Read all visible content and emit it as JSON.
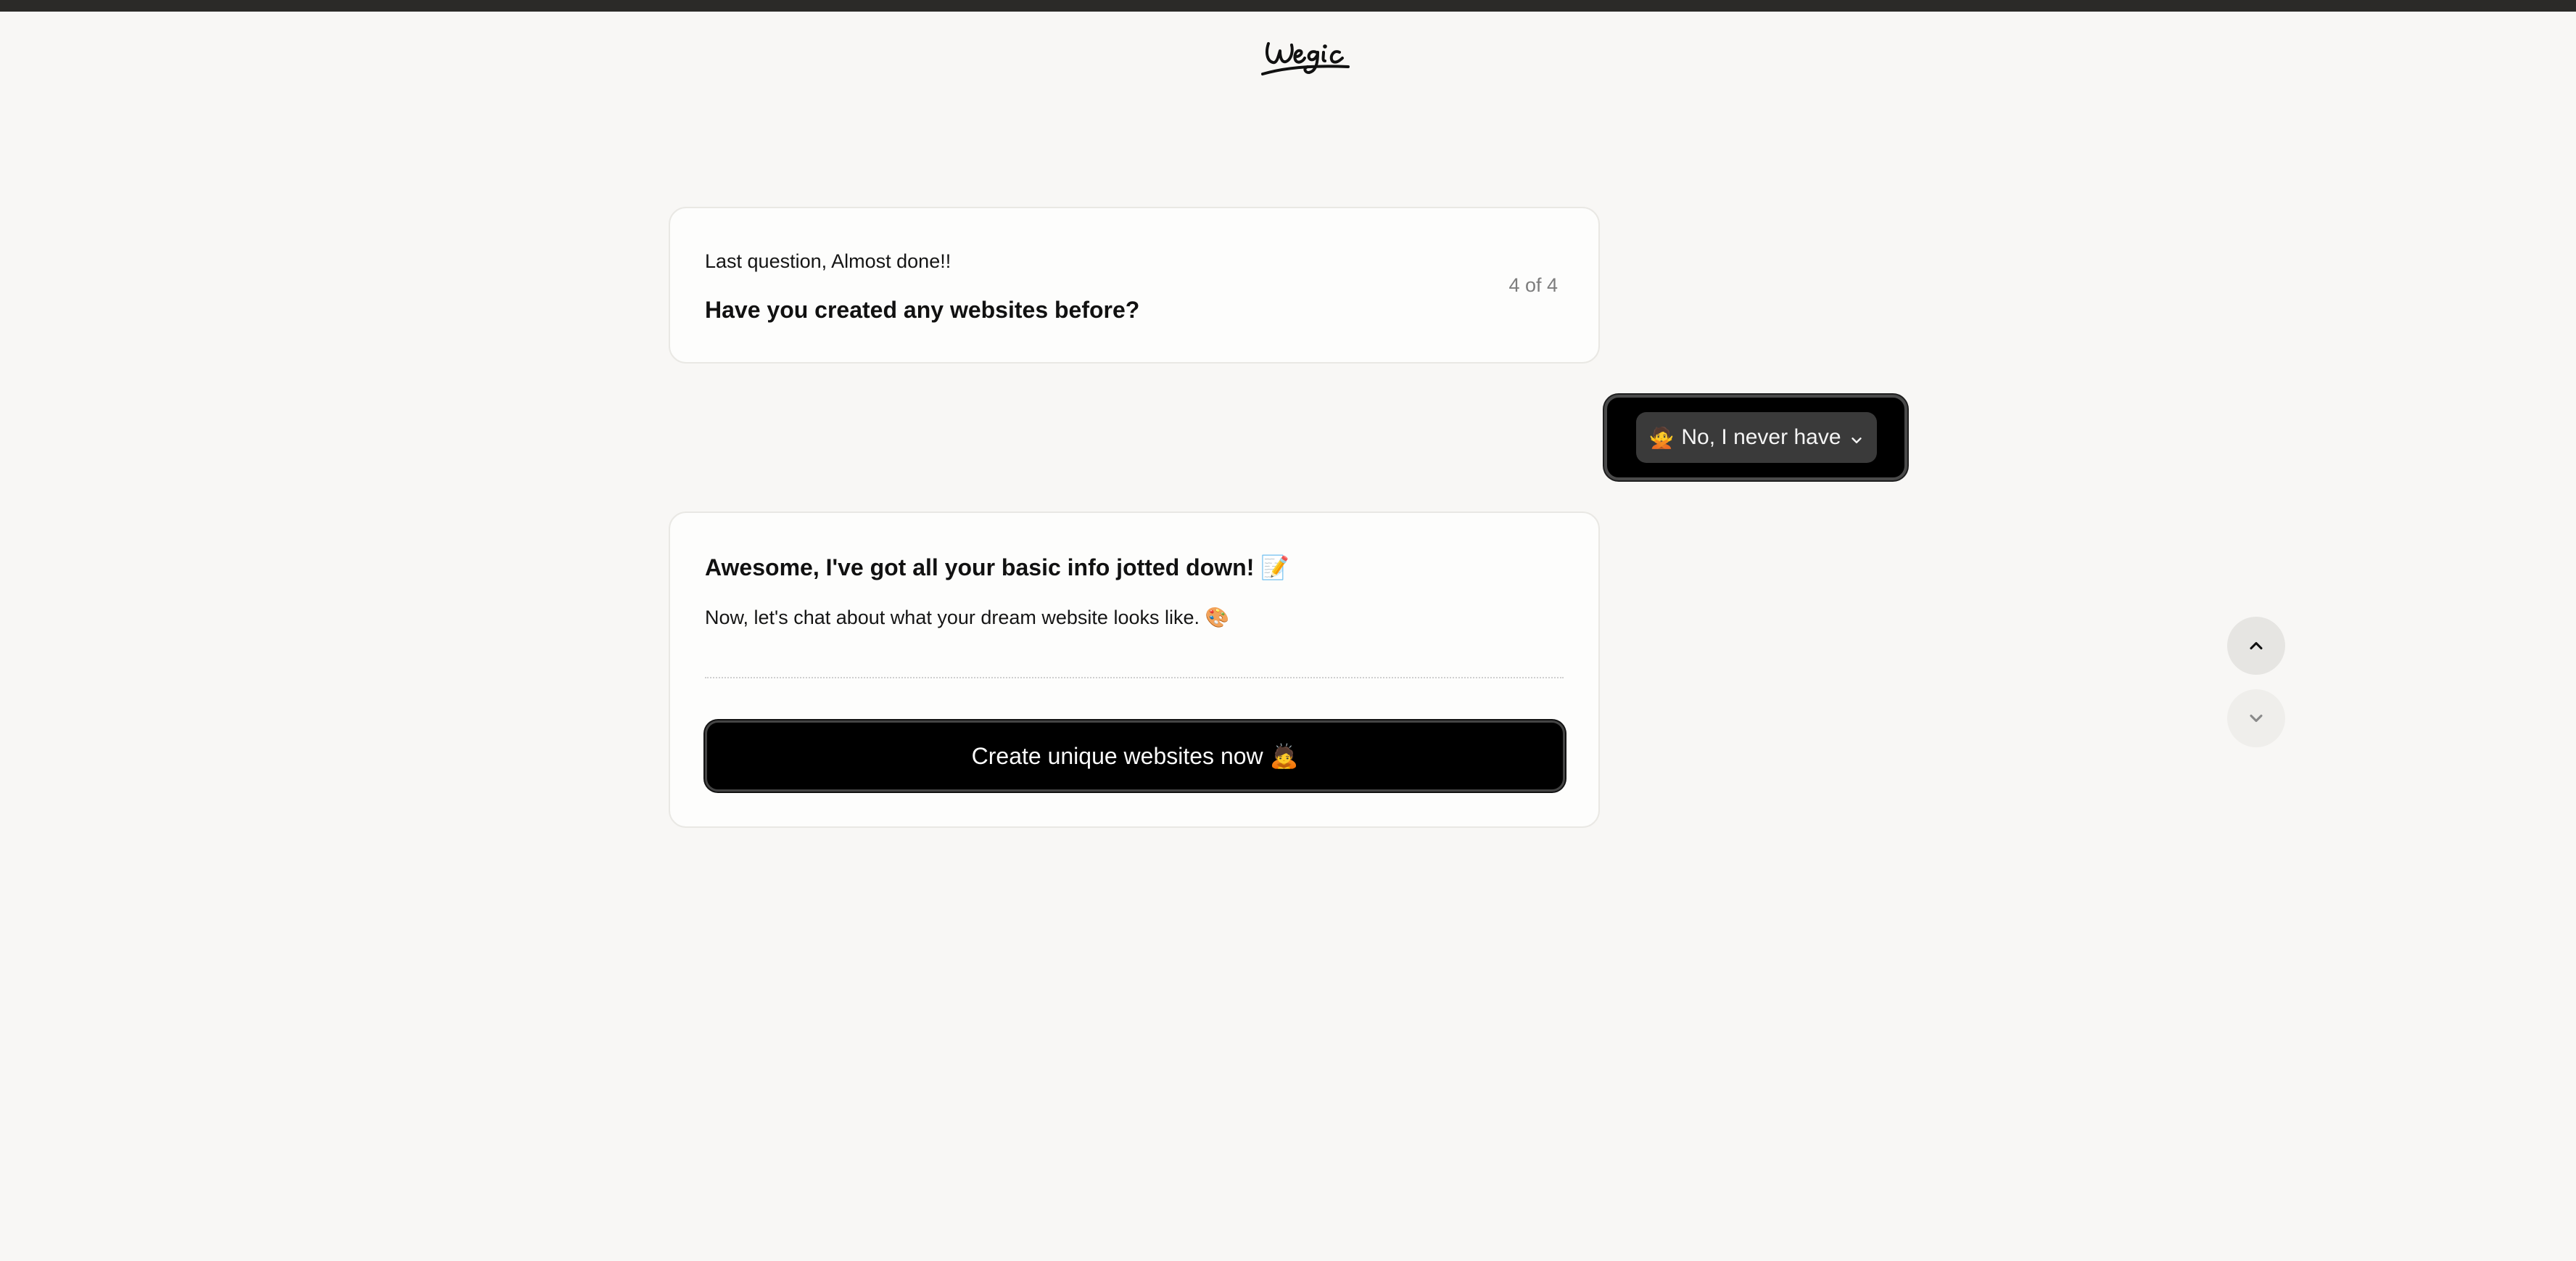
{
  "header": {
    "logo_text": "Wegic"
  },
  "question_card": {
    "label": "Last question, Almost done!!",
    "title": "Have you created any websites before?",
    "counter": "4 of 4"
  },
  "answer": {
    "emoji": "🙅",
    "label": "No, I never have",
    "icon": "chevron-down-icon"
  },
  "summary_card": {
    "title": "Awesome, I've got all your basic info jotted down! 📝",
    "subtitle": "Now, let's chat about what your dream website looks like. 🎨",
    "cta_label": "Create unique websites now 🙇"
  },
  "navigation": {
    "up_icon": "chevron-up-icon",
    "down_icon": "chevron-down-icon"
  },
  "colors": {
    "background": "#f8f7f5",
    "top_bar": "#2b2a28",
    "card_border": "#e9e8e4",
    "primary": "#000000",
    "pill": "#3a3a3a",
    "muted_text": "#7d7d7d"
  }
}
